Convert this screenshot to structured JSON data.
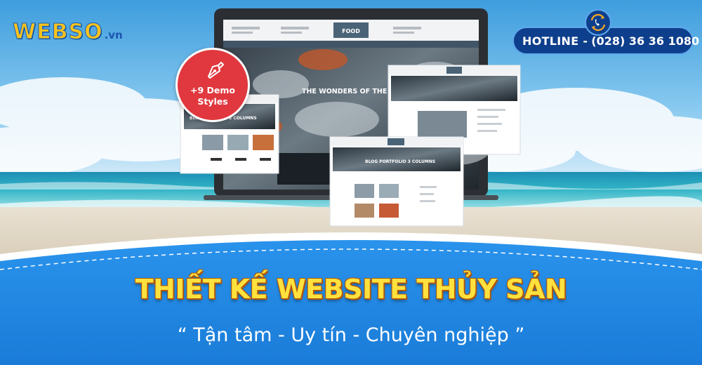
{
  "logo": {
    "name": "WEBSO",
    "ext": ".vn"
  },
  "hotline": {
    "label": "HOTLINE -",
    "number": "(028) 36 36 1080",
    "icon": "phone-cycle-icon"
  },
  "badge": {
    "line1": "+9 Demo",
    "line2": "Styles",
    "icon": "pen-tool-icon"
  },
  "mockups": {
    "laptop_brand": "FOOD",
    "laptop_headline": "THE WONDERS OF THE OC",
    "card_left_title": "BLOG MASONRY 2 COLUMNS",
    "card_front_title": "BLOG PORTFOLIO 3 COLUMNS"
  },
  "headline": {
    "title": "THIẾT KẾ WEBSITE THỦY SẢN",
    "tagline": "“ Tận tâm - Uy tín - Chuyên nghiệp ”"
  },
  "colors": {
    "banner_blue": "#1e88e5",
    "hotline_blue": "#0e3f8c",
    "badge_red": "#e0383e",
    "title_yellow": "#ffe13d"
  }
}
